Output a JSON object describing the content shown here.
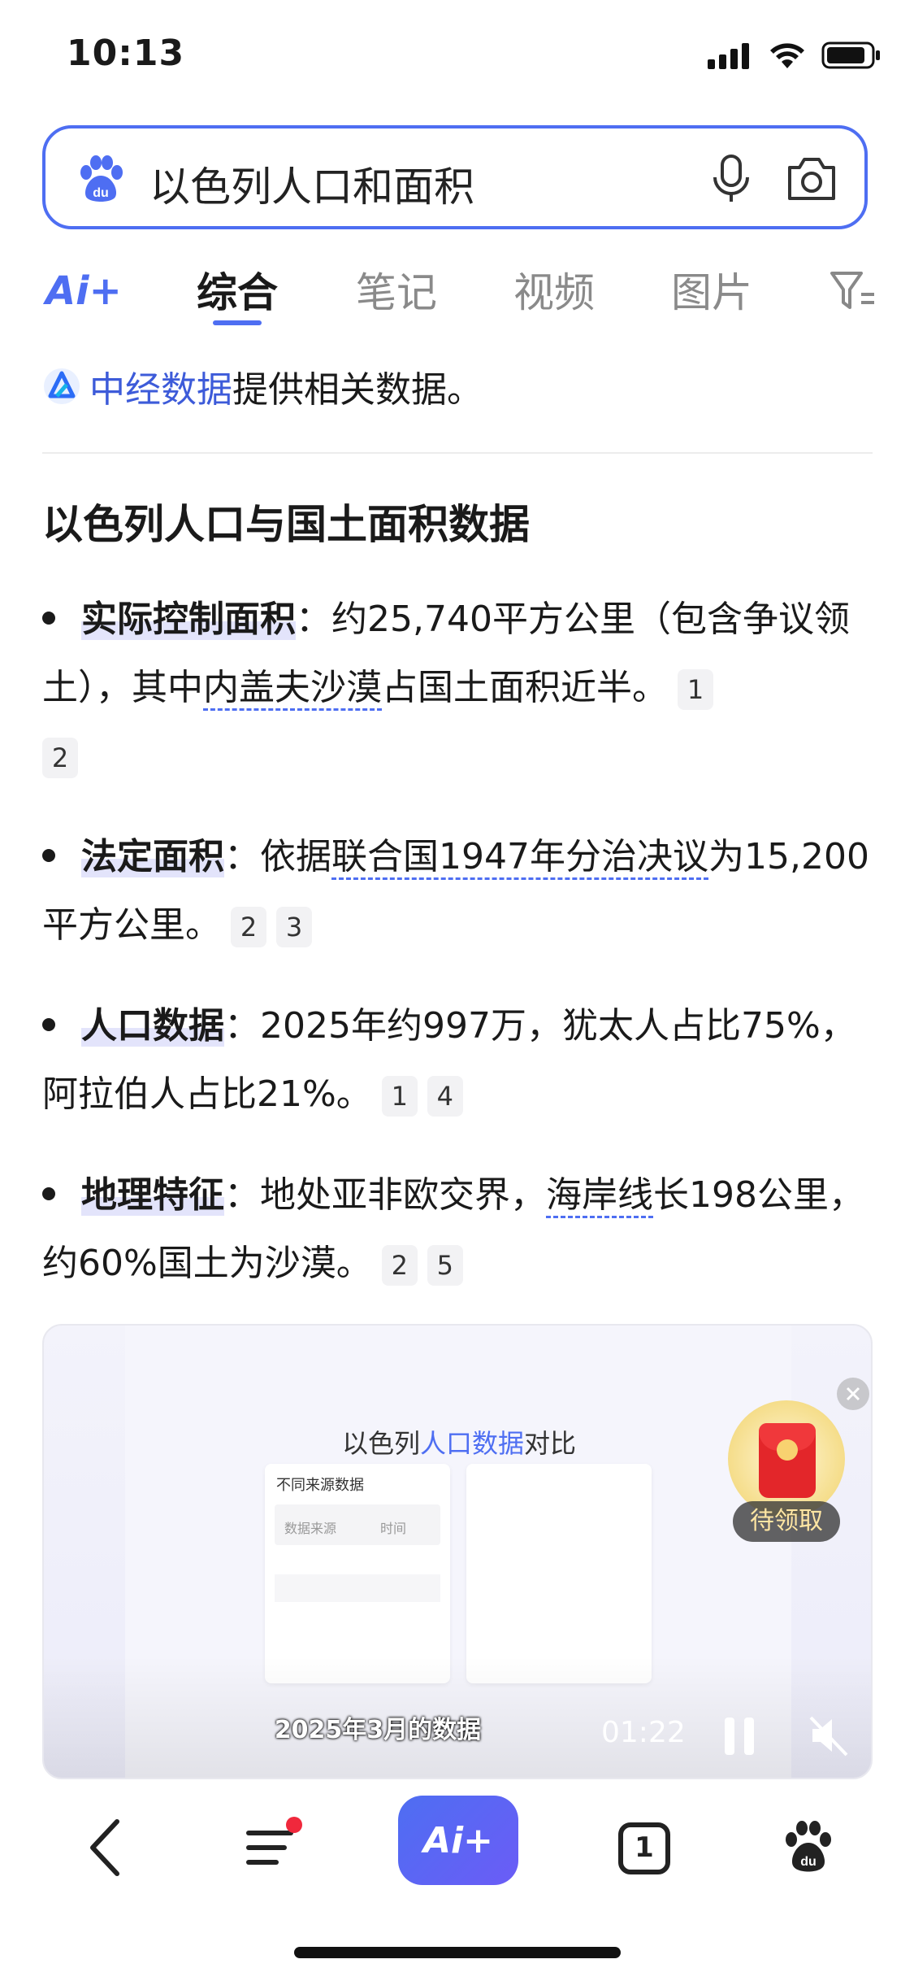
{
  "status": {
    "time": "10:13"
  },
  "search": {
    "query": "以色列人口和面积"
  },
  "tabs": [
    {
      "label": "综合"
    },
    {
      "label": "笔记"
    },
    {
      "label": "视频"
    },
    {
      "label": "图片"
    }
  ],
  "ai_label": "Ai+",
  "source": {
    "name": "中经数据",
    "suffix": "提供相关数据。"
  },
  "article": {
    "heading": "以色列人口与国土面积数据",
    "bullets": [
      {
        "key": "实际控制面积",
        "pre": "：约25,740平方公里（包含争议领土），其中",
        "link": "内盖夫沙漠",
        "post": "占国土面积近半。",
        "refs": [
          "1",
          "2"
        ]
      },
      {
        "key": "法定面积",
        "pre": "：依据",
        "link": "联合国1947年分治决议",
        "post": "为15,200平方公里。",
        "refs": [
          "2",
          "3"
        ]
      },
      {
        "key": "人口数据",
        "pre": "：2025年约997万，犹太人占比75%，阿拉伯人占比21%。",
        "link": "",
        "post": "",
        "refs": [
          "1",
          "4"
        ]
      },
      {
        "key": "地理特征",
        "pre": "：地处亚非欧交界，",
        "link": "海岸线",
        "post": "长198公里，约60%国土为沙漠。",
        "refs": [
          "2",
          "5"
        ]
      }
    ]
  },
  "video": {
    "title_pre": "以色列",
    "title_hl": "人口数据",
    "title_post": "对比",
    "panel_title": "不同来源数据",
    "col1": "数据来源",
    "col2": "时间",
    "subtitle": "2025年3月的数据",
    "time": "01:22"
  },
  "red_packet": {
    "label": "待领取"
  },
  "bottom_nav": {
    "ai_label": "Ai+",
    "tab_count": "1"
  }
}
